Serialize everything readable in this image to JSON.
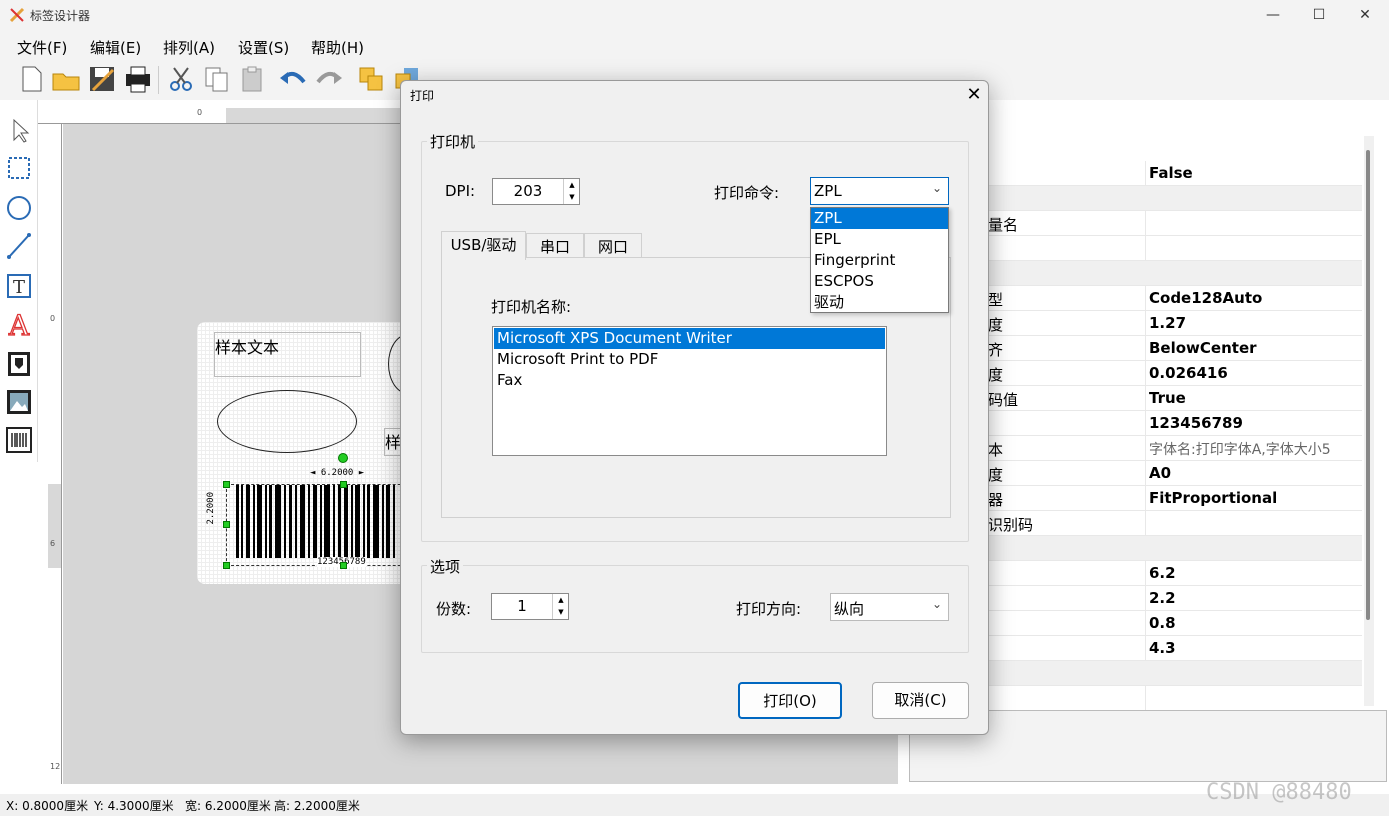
{
  "app": {
    "title": "标签设计器"
  },
  "window_controls": {
    "minimize": "—",
    "maximize": "☐",
    "close": "✕"
  },
  "menu": {
    "items": [
      "文件(F)",
      "编辑(E)",
      "排列(A)",
      "设置(S)",
      "帮助(H)"
    ]
  },
  "toolbar": {
    "icons": [
      "new-file-icon",
      "open-folder-icon",
      "save-icon",
      "print-icon",
      "cut-icon",
      "copy-icon",
      "paste-icon",
      "undo-icon",
      "redo-icon",
      "bring-front-icon",
      "send-back-icon",
      "align-icon",
      "zoom-in-icon",
      "zoom-out-icon",
      "zoom-fit-icon",
      "help-icon"
    ]
  },
  "left_tools": [
    "pointer-tool-icon",
    "rect-select-icon",
    "ellipse-tool-icon",
    "line-tool-icon",
    "text-tool-icon",
    "font-tool-icon",
    "stamp-tool-icon",
    "image-tool-icon",
    "barcode-tool-icon"
  ],
  "rulers": {
    "top_zero": "0",
    "left_marks": [
      "0",
      "6",
      "12"
    ]
  },
  "label": {
    "text_object": "样本文本",
    "width_annotation": "◄ 6.2000 ►",
    "height_annotation": "2.2000",
    "barcode_text": "123456789",
    "partial_text": "样"
  },
  "properties": [
    {
      "name": "",
      "value": "False",
      "category": false
    },
    {
      "name": "",
      "value": "",
      "category": true
    },
    {
      "name": "量名",
      "value": "",
      "category": false
    },
    {
      "name": "",
      "value": "",
      "category": false
    },
    {
      "name": "",
      "value": "",
      "category": true
    },
    {
      "name": "型",
      "value": "Code128Auto",
      "category": false
    },
    {
      "name": "度",
      "value": "1.27",
      "category": false
    },
    {
      "name": "齐",
      "value": "BelowCenter",
      "category": false
    },
    {
      "name": "度",
      "value": "0.026416",
      "category": false
    },
    {
      "name": "码值",
      "value": "True",
      "category": false
    },
    {
      "name": "",
      "value": "123456789",
      "category": false
    },
    {
      "name": "本",
      "value": "字体名:打印字体A,字体大小5",
      "category": false,
      "muted": true
    },
    {
      "name": "度",
      "value": "A0",
      "category": false
    },
    {
      "name": "器",
      "value": "FitProportional",
      "category": false
    },
    {
      "name": "识别码",
      "value": "",
      "category": false
    },
    {
      "name": "",
      "value": "",
      "category": true
    },
    {
      "name": "",
      "value": "6.2",
      "category": false
    },
    {
      "name": "",
      "value": "2.2",
      "category": false
    },
    {
      "name": "",
      "value": "0.8",
      "category": false
    },
    {
      "name": "",
      "value": "4.3",
      "category": false
    },
    {
      "name": "",
      "value": "",
      "category": true
    },
    {
      "name": "",
      "value": "",
      "category": false
    }
  ],
  "status": {
    "x": "X: 0.8000厘米",
    "y": "Y: 4.3000厘米",
    "w": "宽: 6.2000厘米",
    "h": "高: 2.2000厘米"
  },
  "watermark": "CSDN @88480",
  "dialog": {
    "title": "打印",
    "close": "✕",
    "printer_group": "打印机",
    "dpi_label": "DPI:",
    "dpi_value": "203",
    "command_label": "打印命令:",
    "command_value": "ZPL",
    "command_options": [
      "ZPL",
      "EPL",
      "Fingerprint",
      "ESCPOS",
      "驱动"
    ],
    "tabs": [
      "USB/驱动",
      "串口",
      "网口"
    ],
    "printer_name_label": "打印机名称:",
    "printers": [
      "Microsoft XPS Document Writer",
      "Microsoft Print to PDF",
      "Fax"
    ],
    "options_group": "选项",
    "copies_label": "份数:",
    "copies_value": "1",
    "orientation_label": "打印方向:",
    "orientation_value": "纵向",
    "print_button": "打印(O)",
    "cancel_button": "取消(C)"
  },
  "colors": {
    "selection": "#0078d7",
    "accent_border": "#0067c0"
  }
}
